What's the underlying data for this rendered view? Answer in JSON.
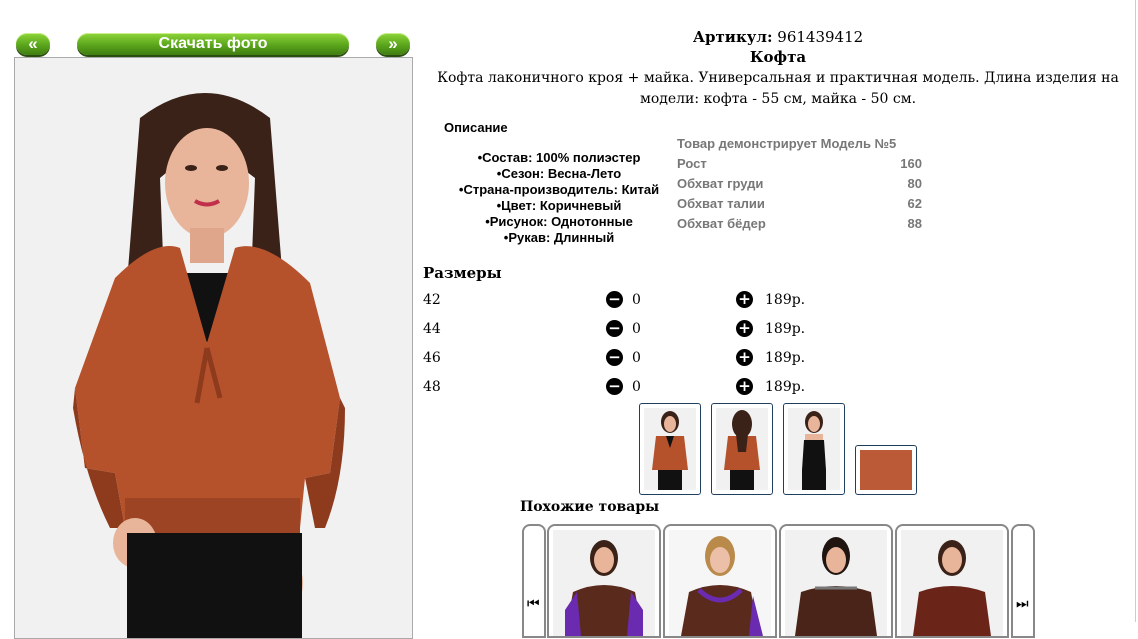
{
  "nav": {
    "prev_label": "«",
    "download_label": "Скачать фото",
    "next_label": "»"
  },
  "product": {
    "article_label": "Артикул:",
    "article_value": "961439412",
    "title": "Кофта",
    "description": "Кофта лаконичного кроя + майка. Универсальная и практичная модель. Длина изделия на модели: кофта - 55 см, майка - 50 см."
  },
  "description_block": {
    "title": "Описание",
    "items": [
      "Состав: 100% полиэстер",
      "Сезон: Весна-Лето",
      "Страна-производитель: Китай",
      "Цвет: Коричневый",
      "Рисунок: Однотонные",
      "Рукав: Длинный"
    ]
  },
  "model": {
    "header": "Товар демонстрирует Модель №5",
    "rows": [
      {
        "label": "Рост",
        "value": "160"
      },
      {
        "label": "Обхват груди",
        "value": "80"
      },
      {
        "label": "Обхват талии",
        "value": "62"
      },
      {
        "label": "Обхват бёдер",
        "value": "88"
      }
    ]
  },
  "sizes": {
    "title": "Размеры",
    "minus_icon": "−",
    "plus_icon": "+",
    "rows": [
      {
        "size": "42",
        "qty": "0",
        "price": "189р."
      },
      {
        "size": "44",
        "qty": "0",
        "price": "189р."
      },
      {
        "size": "46",
        "qty": "0",
        "price": "189р."
      },
      {
        "size": "48",
        "qty": "0",
        "price": "189р."
      }
    ]
  },
  "similar": {
    "title": "Похожие товары",
    "prev_icon": "⏮",
    "next_icon": "⏭"
  },
  "colors": {
    "sweater": "#b5522c",
    "sweater_dark": "#8e3b1d",
    "hair": "#3a2218",
    "skin": "#e8b49a",
    "purple": "#6a2bb0",
    "brown": "#5a2a1c"
  }
}
